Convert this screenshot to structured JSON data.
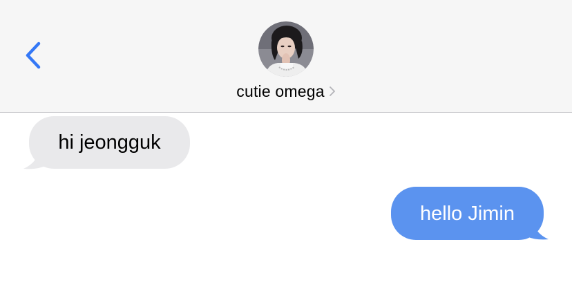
{
  "header": {
    "contact_name": "cutie omega",
    "icons": {
      "back": "chevron-left-icon",
      "avatar": "contact-avatar",
      "details": "chevron-right-icon"
    }
  },
  "messages": [
    {
      "direction": "received",
      "text": "hi jeongguk"
    },
    {
      "direction": "sent",
      "text": "hello Jimin"
    }
  ],
  "colors": {
    "header_background": "#f6f6f6",
    "accent": "#3478f6",
    "received_bubble": "#e9e9eb",
    "sent_bubble": "#5b93ef",
    "divider": "#c8c8cc"
  }
}
